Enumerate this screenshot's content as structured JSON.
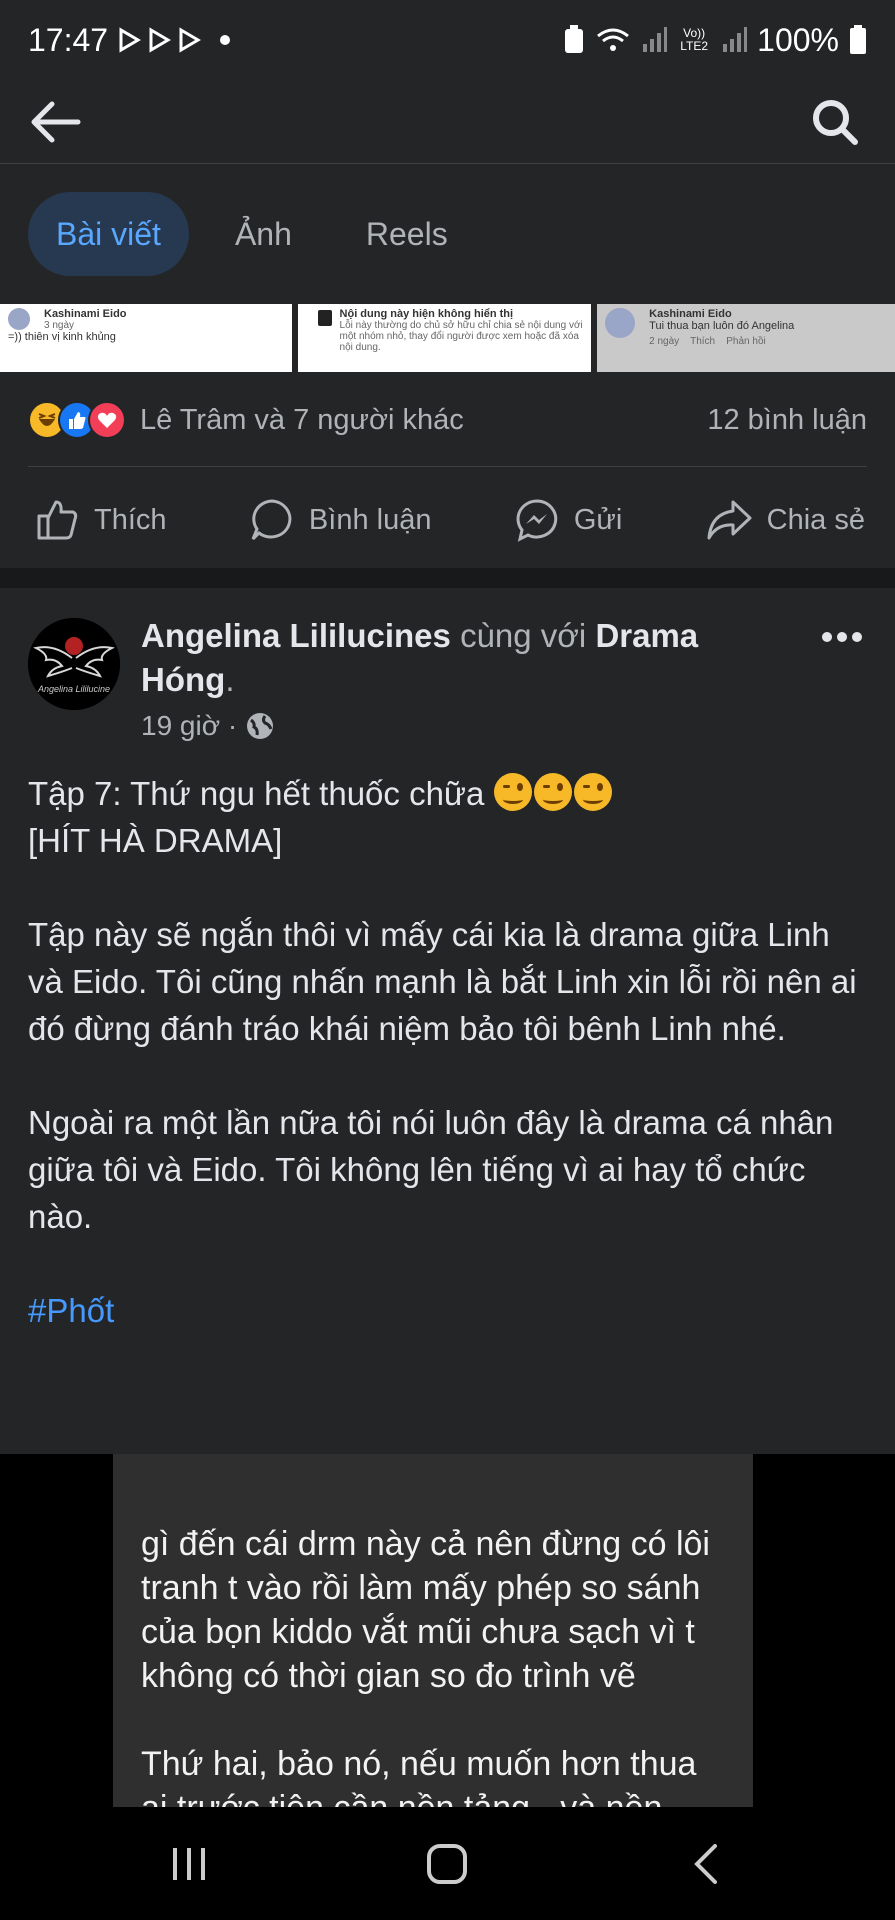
{
  "status_bar": {
    "time": "17:47",
    "battery": "100%",
    "network_label": "Vo)) LTE2"
  },
  "tabs": [
    {
      "label": "Bài viết",
      "active": true
    },
    {
      "label": "Ảnh",
      "active": false
    },
    {
      "label": "Reels",
      "active": false
    }
  ],
  "image_strip": {
    "thumb1": {
      "name": "Kashinami Eido",
      "time": "3 ngày",
      "text": "=)) thiên vị kinh khủng"
    },
    "thumb2": {
      "title": "Nội dung này hiện không hiển thị",
      "text": "Lỗi này thường do chủ sở hữu chỉ chia sẻ nội dung với một nhóm nhỏ, thay đổi người được xem hoặc đã xóa nội dung."
    },
    "thumb3": {
      "name": "Kashinami Eido",
      "text": "Tui thua bạn luôn đó Angelina",
      "time": "2 ngày",
      "like": "Thích",
      "reply": "Phản hồi"
    }
  },
  "reactions": {
    "summary": "Lê Trâm và 7 người khác",
    "comments": "12 bình luận",
    "icons": [
      "haha-icon",
      "like-icon",
      "love-icon"
    ]
  },
  "actions": {
    "like": "Thích",
    "comment": "Bình luận",
    "send": "Gửi",
    "share": "Chia sẻ"
  },
  "post": {
    "author": "Angelina Lililucines",
    "with_text": "cùng với",
    "group": "Drama Hóng",
    "time": "19 giờ ·",
    "avatar_caption": "Angelina Lililucine",
    "title_line": "Tập 7: Thứ ngu hết thuốc chữa ",
    "body": "\n[HÍT HÀ DRAMA]\n\nTập này sẽ ngắn thôi vì mấy cái kia là drama giữa Linh và Eido. Tôi cũng nhấn mạnh là bắt Linh xin lỗi rồi nên ai đó đừng đánh tráo khái niệm bảo tôi bênh Linh nhé.\n\nNgoài ra một lần nữa tôi nói luôn đây là drama cá nhân giữa tôi và Eido. Tôi không lên tiếng vì ai hay tổ chức nào.\n\n",
    "hashtag": "#Phốt"
  },
  "media_text": "gì đến cái drm này cả nên đừng có lôi tranh t vào rồi làm mấy phép so sánh của bọn kiddo vắt mũi chưa sạch vì t không có thời gian so đo trình vẽ\n\nThứ hai, bảo nó, nếu muốn hơn thua ai trước tiên cần nền tảng - và nền tảng thì t lo một ít đó thay đổi",
  "colors": {
    "background": "#242526",
    "accent": "#5aa7ff",
    "hashtag": "#4599ff",
    "tab_active_bg": "#263951",
    "muted": "#b0b3b8"
  }
}
